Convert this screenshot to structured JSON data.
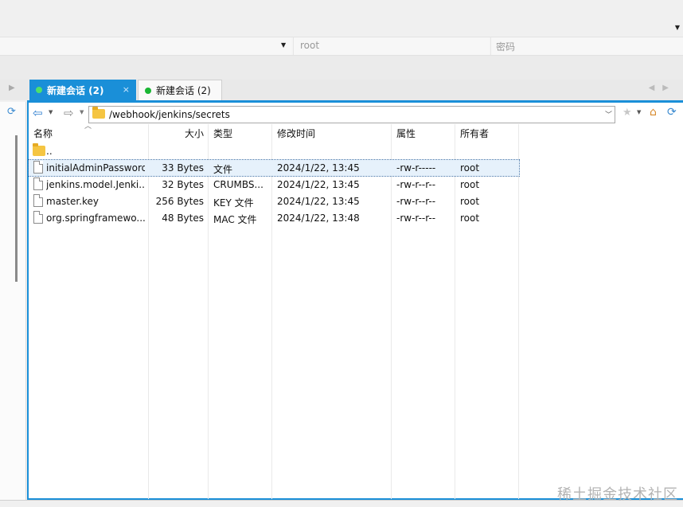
{
  "login": {
    "username": "root",
    "password_placeholder": "密码"
  },
  "tabs": [
    {
      "label": "新建会话 (2)",
      "close": "×"
    },
    {
      "label": "新建会话 (2)"
    }
  ],
  "nav": {
    "path": "/webhook/jenkins/secrets"
  },
  "table": {
    "columns": {
      "name": "名称",
      "size": "大小",
      "type": "类型",
      "modified": "修改时间",
      "attributes": "属性",
      "owner": "所有者"
    },
    "parent": "..",
    "rows": [
      {
        "name": "initialAdminPassword",
        "size": "33 Bytes",
        "type": "文件",
        "modified": "2024/1/22, 13:45",
        "attributes": "-rw-r-----",
        "owner": "root"
      },
      {
        "name": "jenkins.model.Jenki...",
        "size": "32 Bytes",
        "type": "CRUMBS...",
        "modified": "2024/1/22, 13:45",
        "attributes": "-rw-r--r--",
        "owner": "root"
      },
      {
        "name": "master.key",
        "size": "256 Bytes",
        "type": "KEY 文件",
        "modified": "2024/1/22, 13:45",
        "attributes": "-rw-r--r--",
        "owner": "root"
      },
      {
        "name": "org.springframewo...",
        "size": "48 Bytes",
        "type": "MAC 文件",
        "modified": "2024/1/22, 13:48",
        "attributes": "-rw-r--r--",
        "owner": "root"
      }
    ]
  },
  "watermark": "稀土掘金技术社区",
  "colors": {
    "accent": "#1a8fd8",
    "session_dot": "#19b633",
    "selected_row": "#e6f1fb"
  }
}
